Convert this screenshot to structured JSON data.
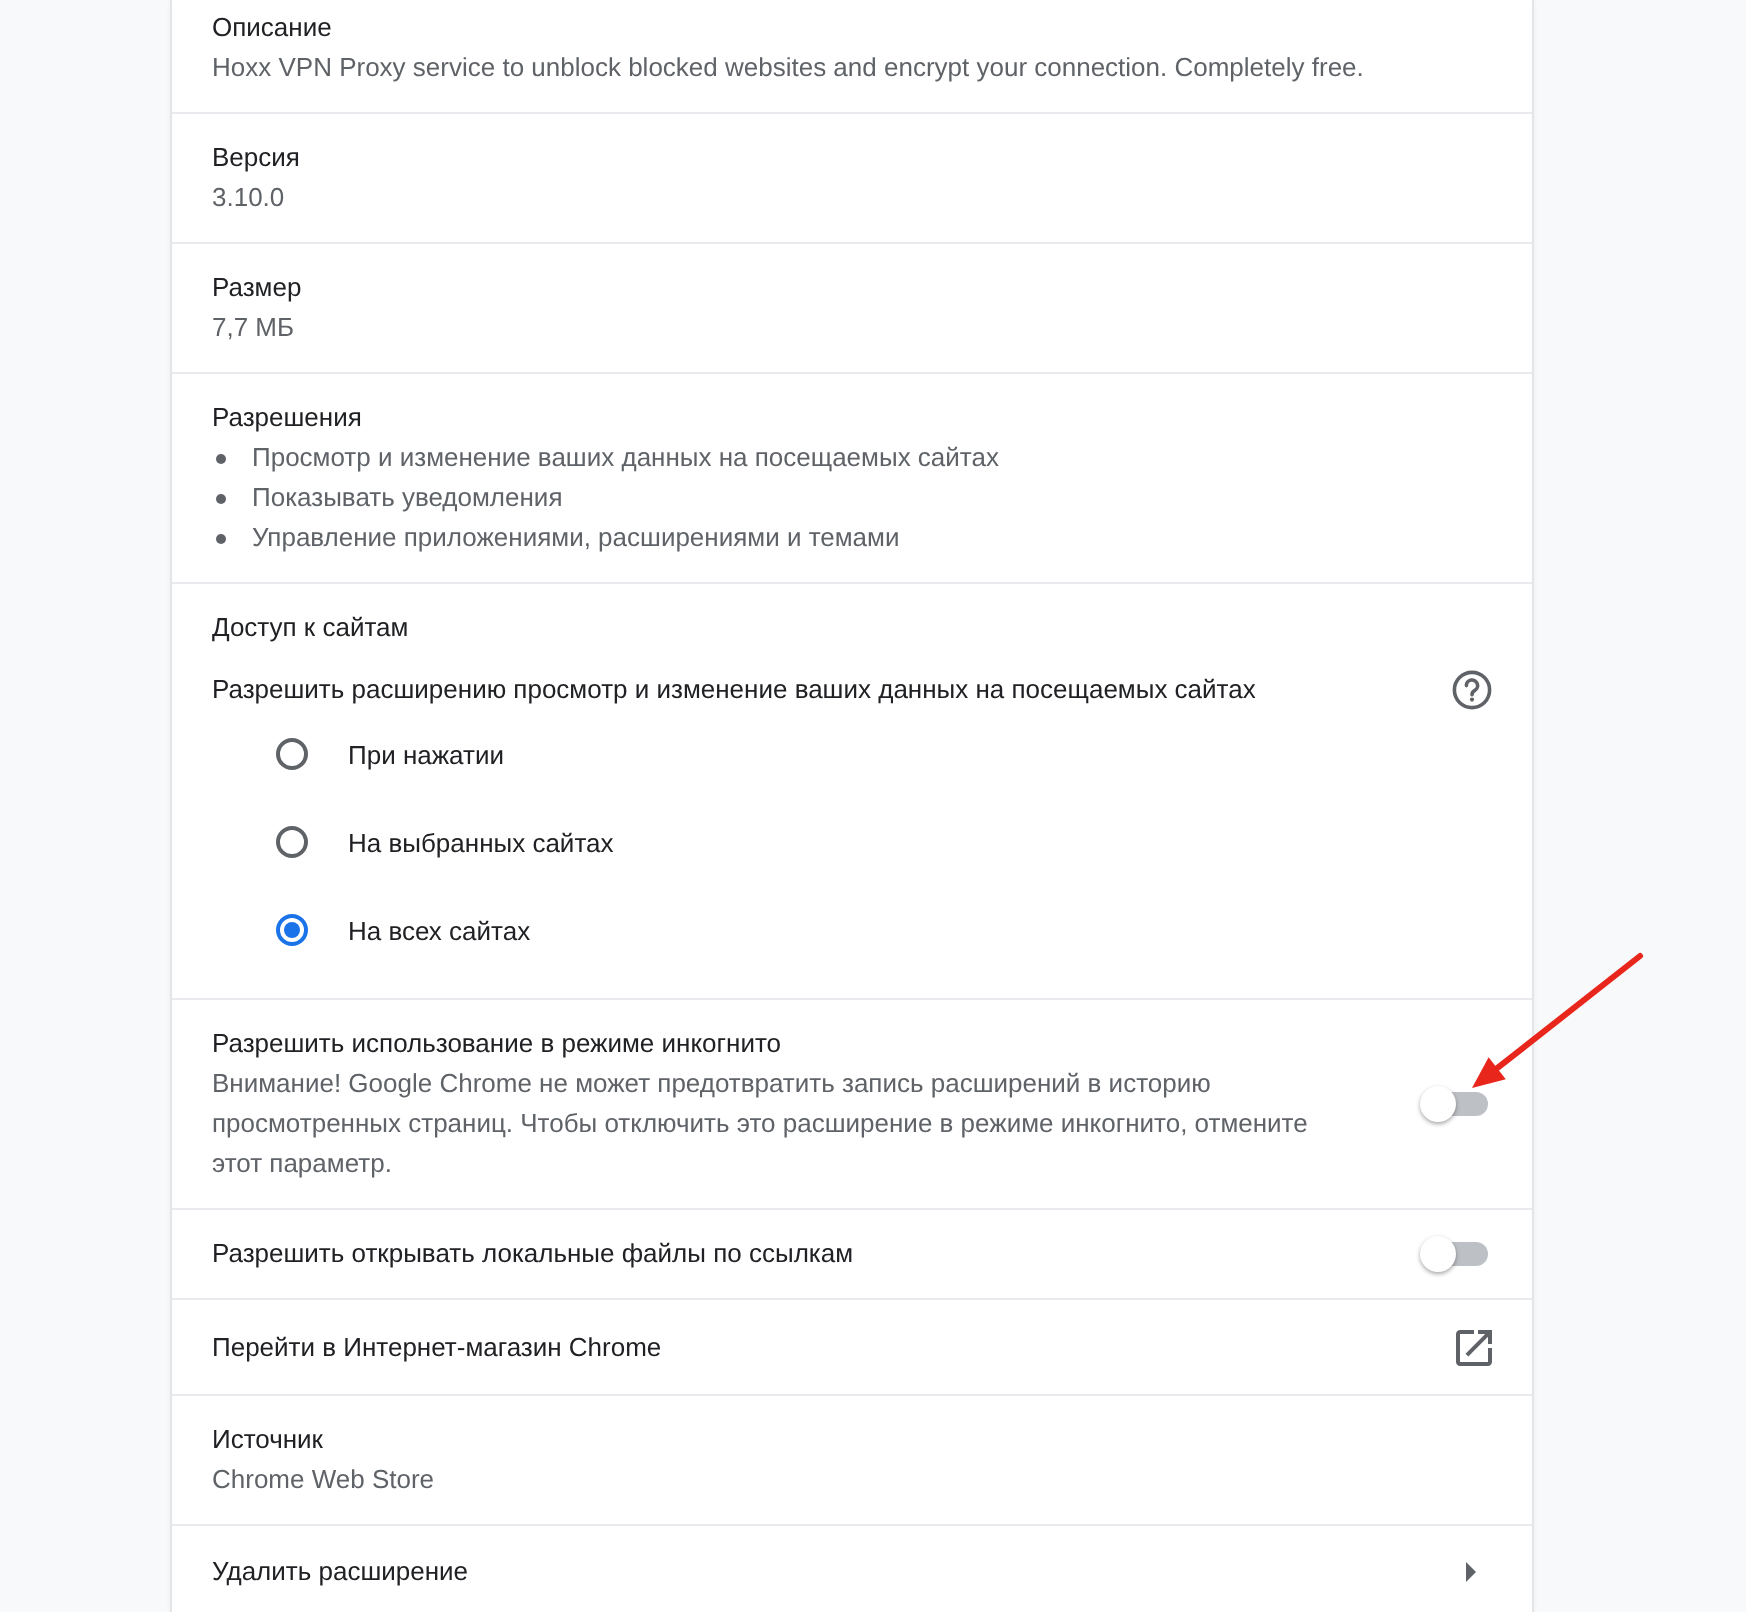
{
  "details": [
    {
      "kind": "info",
      "label": "Описание",
      "value": "Hoxx VPN Proxy service to unblock blocked websites and encrypt your connection. Completely free."
    },
    {
      "kind": "info",
      "label": "Версия",
      "value": "3.10.0"
    },
    {
      "kind": "info",
      "label": "Размер",
      "value": "7,7 МБ"
    },
    {
      "kind": "list",
      "label": "Разрешения",
      "items": [
        "Просмотр и изменение ваших данных на посещаемых сайтах",
        "Показывать уведомления",
        "Управление приложениями, расширениями и темами"
      ]
    },
    {
      "kind": "site_access",
      "label": "Доступ к сайтам",
      "description": "Разрешить расширению просмотр и изменение ваших данных на посещаемых сайтах",
      "options": [
        {
          "label": "При нажатии",
          "selected": false
        },
        {
          "label": "На выбранных сайтах",
          "selected": false
        },
        {
          "label": "На всех сайтах",
          "selected": true
        }
      ]
    },
    {
      "kind": "toggle",
      "label": "Разрешить использование в режиме инкогнито",
      "note": "Внимание! Google Chrome не может предотвратить запись расширений в историю просмотренных страниц. Чтобы отключить это расширение в режиме инкогнито, отмените этот параметр.",
      "on": false
    },
    {
      "kind": "toggle",
      "label": "Разрешить открывать локальные файлы по ссылкам",
      "on": false
    },
    {
      "kind": "link",
      "label": "Перейти в Интернет-магазин Chrome"
    },
    {
      "kind": "info",
      "label": "Источник",
      "value": "Chrome Web Store"
    },
    {
      "kind": "submenu",
      "label": "Удалить расширение"
    }
  ]
}
